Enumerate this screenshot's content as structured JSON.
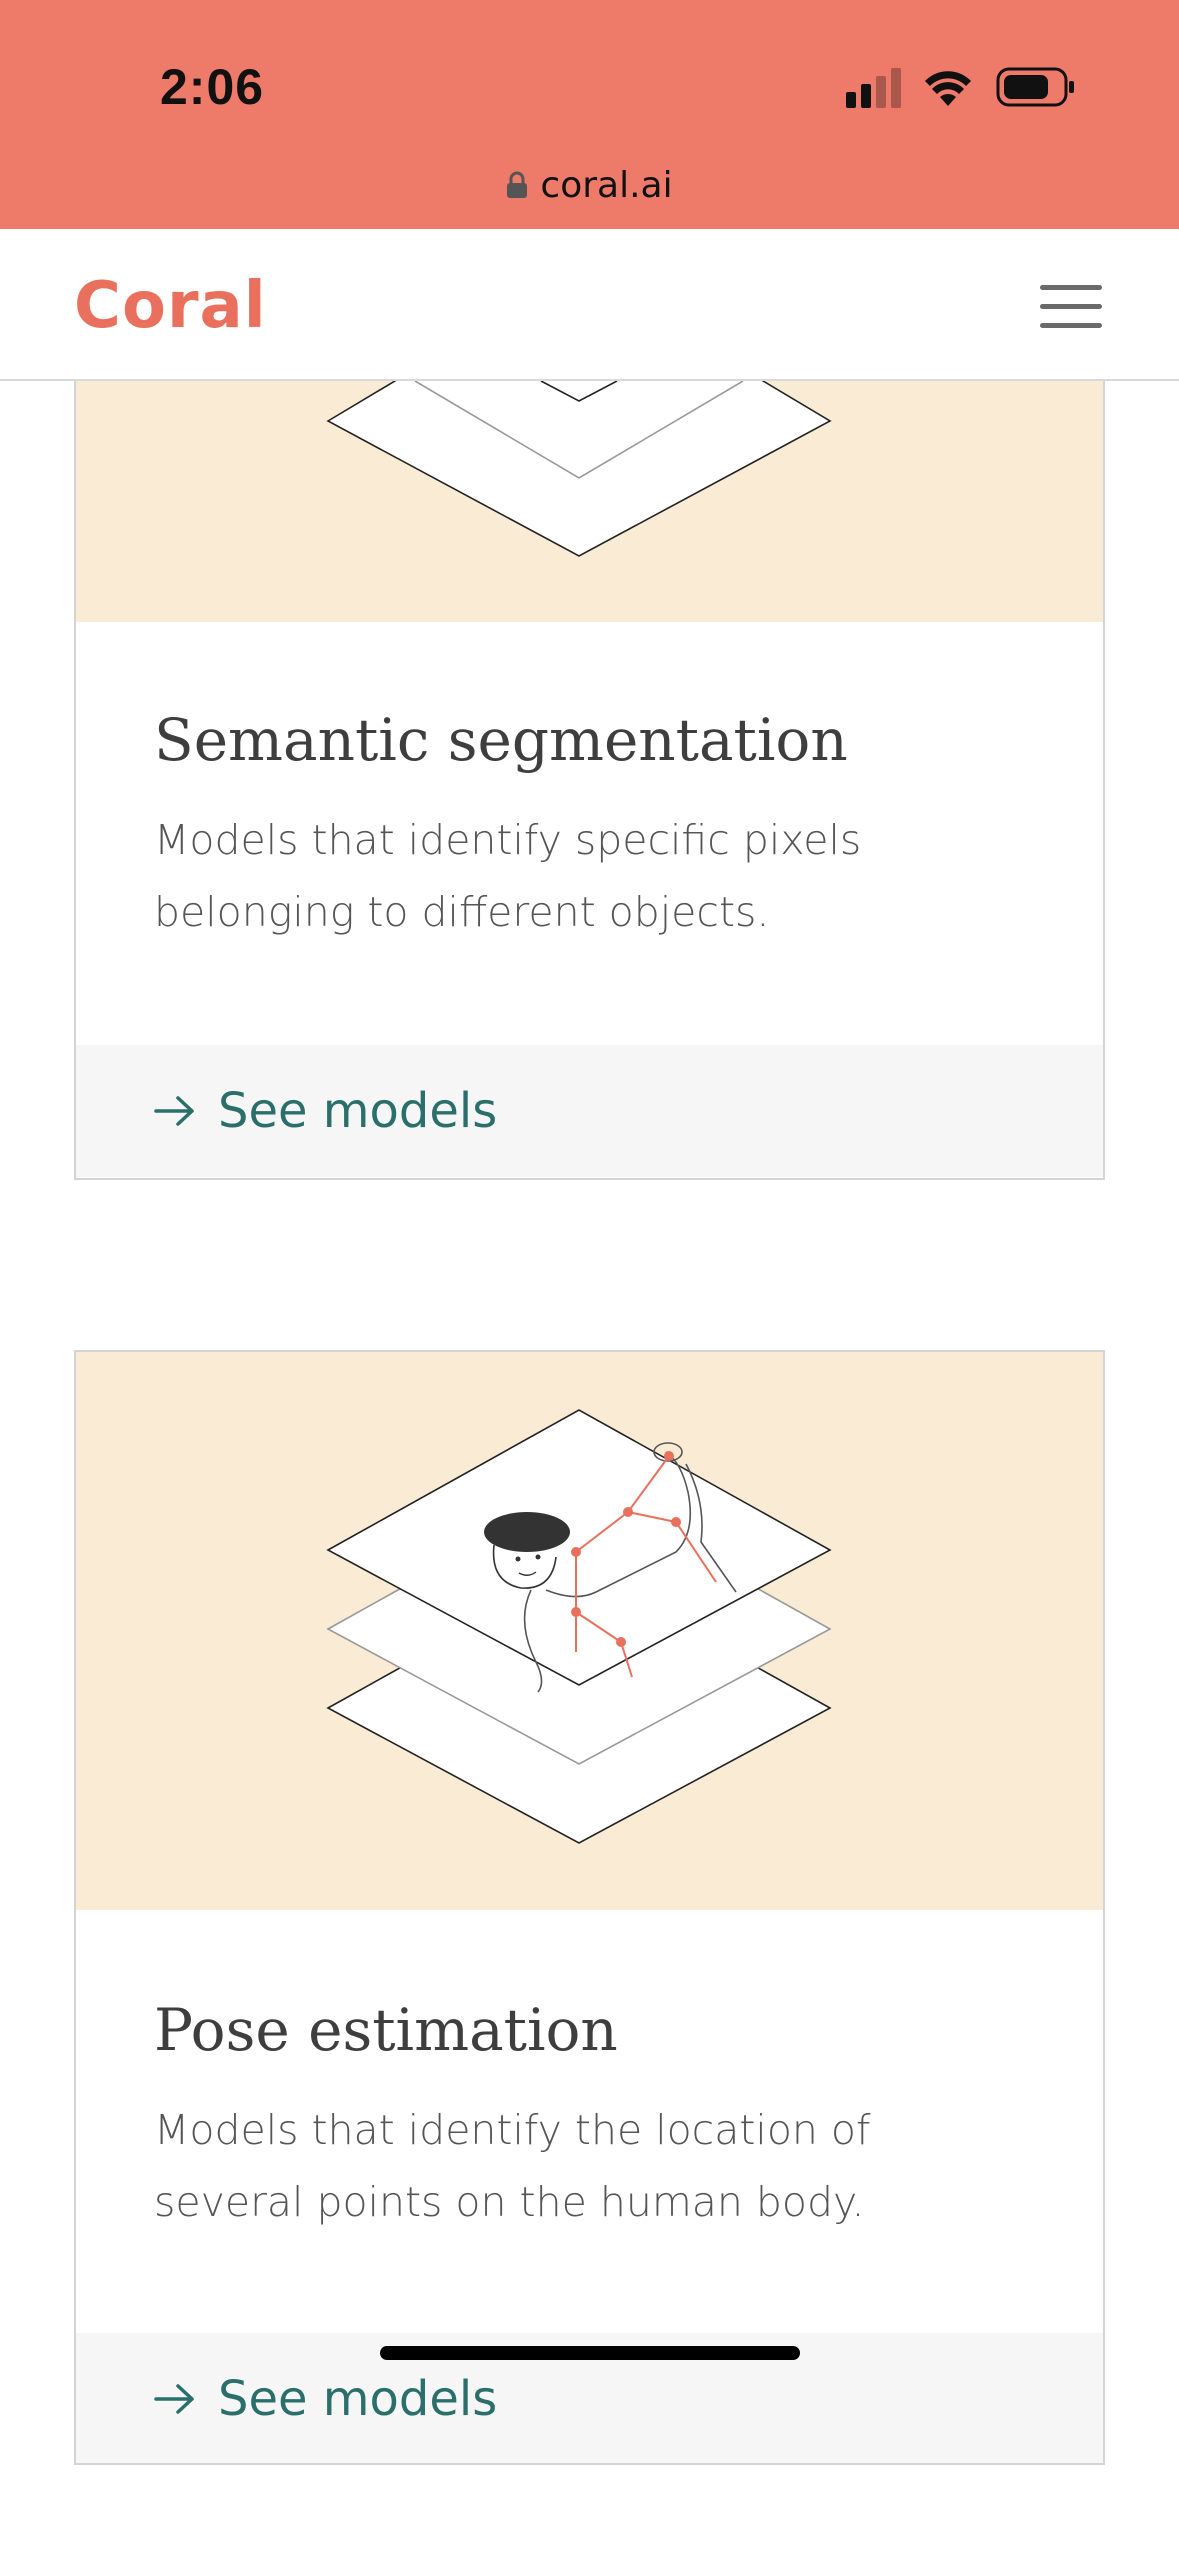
{
  "status_bar": {
    "time": "2:06",
    "signal_icon": "cellular-signal-icon",
    "wifi_icon": "wifi-icon",
    "battery_icon": "battery-icon"
  },
  "browser": {
    "url": "coral.ai",
    "lock_icon": "lock-icon"
  },
  "header": {
    "logo": "Coral",
    "menu_icon": "hamburger-menu-icon"
  },
  "colors": {
    "status_bg": "#EE7A6A",
    "brand": "#E8705D",
    "illustration_bg": "#FAEBD4",
    "link": "#2B6F6B"
  },
  "cards": [
    {
      "title": "Semantic segmentation",
      "description": "Models that identify specific pixels belonging to different objects.",
      "link_label": "See models",
      "link_icon": "arrow-right-icon"
    },
    {
      "title": "Pose estimation",
      "description": "Models that identify the location of several points on the human body.",
      "link_label": "See models",
      "link_icon": "arrow-right-icon"
    }
  ]
}
